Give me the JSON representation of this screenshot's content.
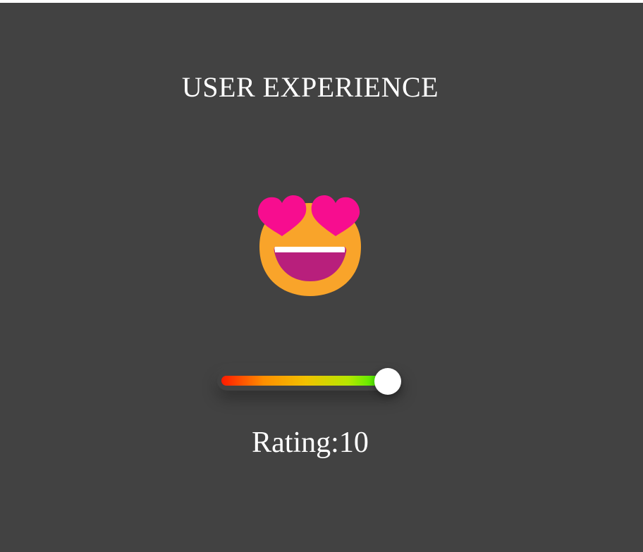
{
  "header": {
    "title": "USER EXPERIENCE"
  },
  "emoji": {
    "icon": "smiling-face-with-heart-eyes-icon",
    "face_color": "#f9a42a",
    "heart_color": "#f70d8f",
    "mouth_color": "#b81f7c"
  },
  "slider": {
    "min": 0,
    "max": 10,
    "value": 10,
    "gradient_colors": [
      "#ff1a00",
      "#ff8f00",
      "#f2c200",
      "#b6e800",
      "#18ee00"
    ]
  },
  "rating": {
    "label": "Rating:",
    "value": "10"
  }
}
